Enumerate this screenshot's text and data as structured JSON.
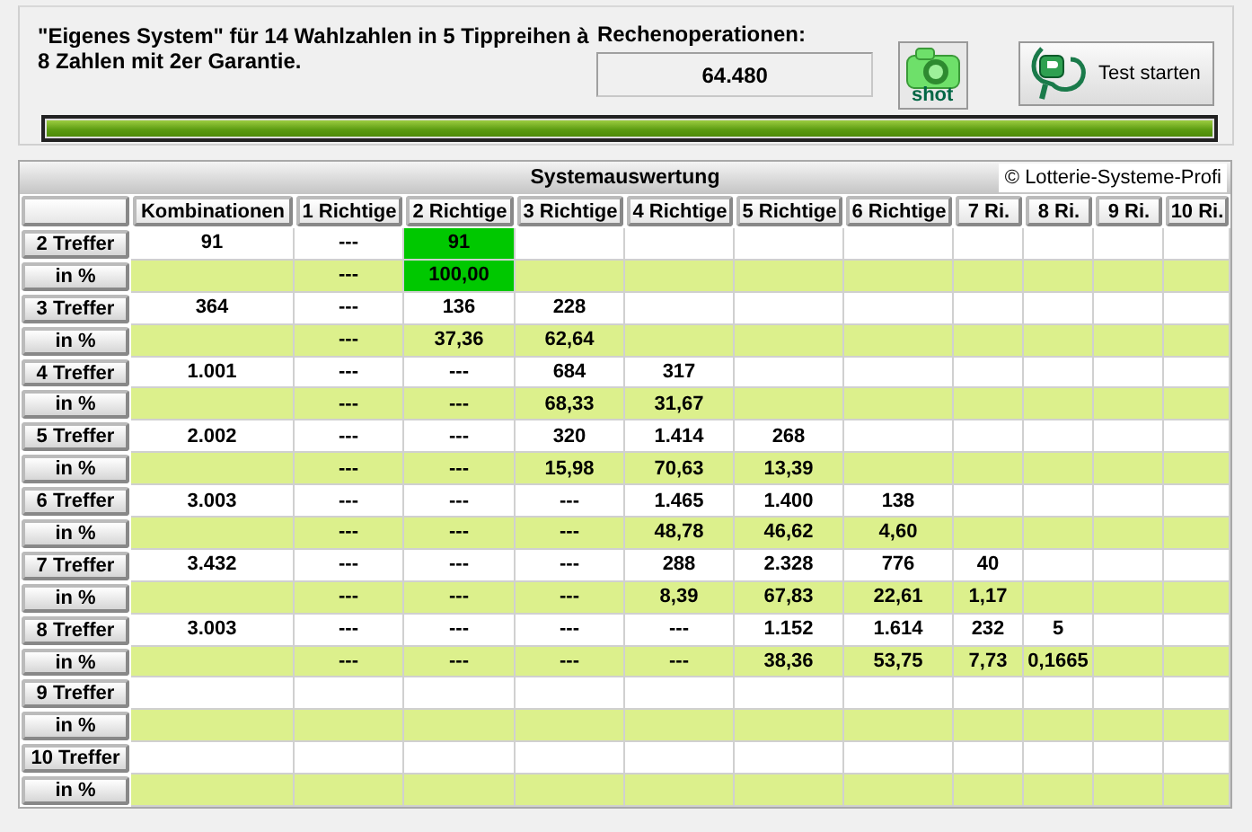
{
  "header": {
    "description": "\"Eigenes System\" für 14 Wahlzahlen in 5 Tippreihen à 8 Zahlen mit 2er Garantie.",
    "operations_label": "Rechenoperationen:",
    "operations_value": "64.480",
    "shot_button": "shot",
    "test_button": "Test starten",
    "progress": {
      "level": 1.0
    }
  },
  "table": {
    "title": "Systemauswertung",
    "copyright": "© Lotterie-Systeme-Profi",
    "columns": [
      "Kombinationen",
      "1 Richtige",
      "2 Richtige",
      "3 Richtige",
      "4 Richtige",
      "5 Richtige",
      "6 Richtige",
      "7 Ri.",
      "8 Ri.",
      "9 Ri.",
      "10 Ri."
    ],
    "rows": [
      {
        "label": "2 Treffer",
        "kind": "count",
        "cells": [
          {
            "value": "91",
            "highlighted": false
          },
          {
            "value": "---",
            "highlighted": false
          },
          {
            "value": "91",
            "highlighted": true
          },
          {
            "highlighted": false
          },
          {
            "highlighted": false
          },
          {
            "highlighted": false
          },
          {
            "highlighted": false
          },
          {
            "highlighted": false
          },
          {
            "highlighted": false
          },
          {
            "highlighted": false
          },
          {
            "highlighted": false
          }
        ]
      },
      {
        "label": "in %",
        "kind": "percent",
        "cells": [
          {
            "highlighted": false
          },
          {
            "value": "---",
            "highlighted": false
          },
          {
            "value": "100,00",
            "highlighted": true
          },
          {
            "highlighted": false
          },
          {
            "highlighted": false
          },
          {
            "highlighted": false
          },
          {
            "highlighted": false
          },
          {
            "highlighted": false
          },
          {
            "highlighted": false
          },
          {
            "highlighted": false
          },
          {
            "highlighted": false
          }
        ]
      },
      {
        "label": "3 Treffer",
        "kind": "count",
        "cells": [
          {
            "value": "364",
            "highlighted": false
          },
          {
            "value": "---",
            "highlighted": false
          },
          {
            "value": "136",
            "highlighted": false
          },
          {
            "value": "228",
            "highlighted": false
          },
          {
            "highlighted": false
          },
          {
            "highlighted": false
          },
          {
            "highlighted": false
          },
          {
            "highlighted": false
          },
          {
            "highlighted": false
          },
          {
            "highlighted": false
          },
          {
            "highlighted": false
          }
        ]
      },
      {
        "label": "in %",
        "kind": "percent",
        "cells": [
          {
            "highlighted": false
          },
          {
            "value": "---",
            "highlighted": false
          },
          {
            "value": "37,36",
            "highlighted": false
          },
          {
            "value": "62,64",
            "highlighted": false
          },
          {
            "highlighted": false
          },
          {
            "highlighted": false
          },
          {
            "highlighted": false
          },
          {
            "highlighted": false
          },
          {
            "highlighted": false
          },
          {
            "highlighted": false
          },
          {
            "highlighted": false
          }
        ]
      },
      {
        "label": "4 Treffer",
        "kind": "count",
        "cells": [
          {
            "value": "1.001",
            "highlighted": false
          },
          {
            "value": "---",
            "highlighted": false
          },
          {
            "value": "---",
            "highlighted": false
          },
          {
            "value": "684",
            "highlighted": false
          },
          {
            "value": "317",
            "highlighted": false
          },
          {
            "highlighted": false
          },
          {
            "highlighted": false
          },
          {
            "highlighted": false
          },
          {
            "highlighted": false
          },
          {
            "highlighted": false
          },
          {
            "highlighted": false
          }
        ]
      },
      {
        "label": "in %",
        "kind": "percent",
        "cells": [
          {
            "highlighted": false
          },
          {
            "value": "---",
            "highlighted": false
          },
          {
            "value": "---",
            "highlighted": false
          },
          {
            "value": "68,33",
            "highlighted": false
          },
          {
            "value": "31,67",
            "highlighted": false
          },
          {
            "highlighted": false
          },
          {
            "highlighted": false
          },
          {
            "highlighted": false
          },
          {
            "highlighted": false
          },
          {
            "highlighted": false
          },
          {
            "highlighted": false
          }
        ]
      },
      {
        "label": "5 Treffer",
        "kind": "count",
        "cells": [
          {
            "value": "2.002",
            "highlighted": false
          },
          {
            "value": "---",
            "highlighted": false
          },
          {
            "value": "---",
            "highlighted": false
          },
          {
            "value": "320",
            "highlighted": false
          },
          {
            "value": "1.414",
            "highlighted": false
          },
          {
            "value": "268",
            "highlighted": false
          },
          {
            "highlighted": false
          },
          {
            "highlighted": false
          },
          {
            "highlighted": false
          },
          {
            "highlighted": false
          },
          {
            "highlighted": false
          }
        ]
      },
      {
        "label": "in %",
        "kind": "percent",
        "cells": [
          {
            "highlighted": false
          },
          {
            "value": "---",
            "highlighted": false
          },
          {
            "value": "---",
            "highlighted": false
          },
          {
            "value": "15,98",
            "highlighted": false
          },
          {
            "value": "70,63",
            "highlighted": false
          },
          {
            "value": "13,39",
            "highlighted": false
          },
          {
            "highlighted": false
          },
          {
            "highlighted": false
          },
          {
            "highlighted": false
          },
          {
            "highlighted": false
          },
          {
            "highlighted": false
          }
        ]
      },
      {
        "label": "6 Treffer",
        "kind": "count",
        "cells": [
          {
            "value": "3.003",
            "highlighted": false
          },
          {
            "value": "---",
            "highlighted": false
          },
          {
            "value": "---",
            "highlighted": false
          },
          {
            "value": "---",
            "highlighted": false
          },
          {
            "value": "1.465",
            "highlighted": false
          },
          {
            "value": "1.400",
            "highlighted": false
          },
          {
            "value": "138",
            "highlighted": false
          },
          {
            "highlighted": false
          },
          {
            "highlighted": false
          },
          {
            "highlighted": false
          },
          {
            "highlighted": false
          }
        ]
      },
      {
        "label": "in %",
        "kind": "percent",
        "cells": [
          {
            "highlighted": false
          },
          {
            "value": "---",
            "highlighted": false
          },
          {
            "value": "---",
            "highlighted": false
          },
          {
            "value": "---",
            "highlighted": false
          },
          {
            "value": "48,78",
            "highlighted": false
          },
          {
            "value": "46,62",
            "highlighted": false
          },
          {
            "value": "4,60",
            "highlighted": false
          },
          {
            "highlighted": false
          },
          {
            "highlighted": false
          },
          {
            "highlighted": false
          },
          {
            "highlighted": false
          }
        ]
      },
      {
        "label": "7 Treffer",
        "kind": "count",
        "cells": [
          {
            "value": "3.432",
            "highlighted": false
          },
          {
            "value": "---",
            "highlighted": false
          },
          {
            "value": "---",
            "highlighted": false
          },
          {
            "value": "---",
            "highlighted": false
          },
          {
            "value": "288",
            "highlighted": false
          },
          {
            "value": "2.328",
            "highlighted": false
          },
          {
            "value": "776",
            "highlighted": false
          },
          {
            "value": "40",
            "highlighted": false
          },
          {
            "highlighted": false
          },
          {
            "highlighted": false
          },
          {
            "highlighted": false
          }
        ]
      },
      {
        "label": "in %",
        "kind": "percent",
        "cells": [
          {
            "highlighted": false
          },
          {
            "value": "---",
            "highlighted": false
          },
          {
            "value": "---",
            "highlighted": false
          },
          {
            "value": "---",
            "highlighted": false
          },
          {
            "value": "8,39",
            "highlighted": false
          },
          {
            "value": "67,83",
            "highlighted": false
          },
          {
            "value": "22,61",
            "highlighted": false
          },
          {
            "value": "1,17",
            "highlighted": false
          },
          {
            "highlighted": false
          },
          {
            "highlighted": false
          },
          {
            "highlighted": false
          }
        ]
      },
      {
        "label": "8 Treffer",
        "kind": "count",
        "cells": [
          {
            "value": "3.003",
            "highlighted": false
          },
          {
            "value": "---",
            "highlighted": false
          },
          {
            "value": "---",
            "highlighted": false
          },
          {
            "value": "---",
            "highlighted": false
          },
          {
            "value": "---",
            "highlighted": false
          },
          {
            "value": "1.152",
            "highlighted": false
          },
          {
            "value": "1.614",
            "highlighted": false
          },
          {
            "value": "232",
            "highlighted": false
          },
          {
            "value": "5",
            "highlighted": false
          },
          {
            "highlighted": false
          },
          {
            "highlighted": false
          }
        ]
      },
      {
        "label": "in %",
        "kind": "percent",
        "cells": [
          {
            "highlighted": false
          },
          {
            "value": "---",
            "highlighted": false
          },
          {
            "value": "---",
            "highlighted": false
          },
          {
            "value": "---",
            "highlighted": false
          },
          {
            "value": "---",
            "highlighted": false
          },
          {
            "value": "38,36",
            "highlighted": false
          },
          {
            "value": "53,75",
            "highlighted": false
          },
          {
            "value": "7,73",
            "highlighted": false
          },
          {
            "value": "0,1665",
            "highlighted": false
          },
          {
            "highlighted": false
          },
          {
            "highlighted": false
          }
        ]
      },
      {
        "label": "9 Treffer",
        "kind": "count",
        "cells": [
          {
            "highlighted": false
          },
          {
            "highlighted": false
          },
          {
            "highlighted": false
          },
          {
            "highlighted": false
          },
          {
            "highlighted": false
          },
          {
            "highlighted": false
          },
          {
            "highlighted": false
          },
          {
            "highlighted": false
          },
          {
            "highlighted": false
          },
          {
            "highlighted": false
          },
          {
            "highlighted": false
          }
        ]
      },
      {
        "label": "in %",
        "kind": "percent",
        "cells": [
          {
            "highlighted": false
          },
          {
            "highlighted": false
          },
          {
            "highlighted": false
          },
          {
            "highlighted": false
          },
          {
            "highlighted": false
          },
          {
            "highlighted": false
          },
          {
            "highlighted": false
          },
          {
            "highlighted": false
          },
          {
            "highlighted": false
          },
          {
            "highlighted": false
          },
          {
            "highlighted": false
          }
        ]
      },
      {
        "label": "10 Treffer",
        "kind": "count",
        "cells": [
          {
            "highlighted": false
          },
          {
            "highlighted": false
          },
          {
            "highlighted": false
          },
          {
            "highlighted": false
          },
          {
            "highlighted": false
          },
          {
            "highlighted": false
          },
          {
            "highlighted": false
          },
          {
            "highlighted": false
          },
          {
            "highlighted": false
          },
          {
            "highlighted": false
          },
          {
            "highlighted": false
          }
        ]
      },
      {
        "label": "in %",
        "kind": "percent",
        "cells": [
          {
            "highlighted": false
          },
          {
            "highlighted": false
          },
          {
            "highlighted": false
          },
          {
            "highlighted": false
          },
          {
            "highlighted": false
          },
          {
            "highlighted": false
          },
          {
            "highlighted": false
          },
          {
            "highlighted": false
          },
          {
            "highlighted": false
          },
          {
            "highlighted": false
          },
          {
            "highlighted": false
          }
        ]
      }
    ]
  }
}
